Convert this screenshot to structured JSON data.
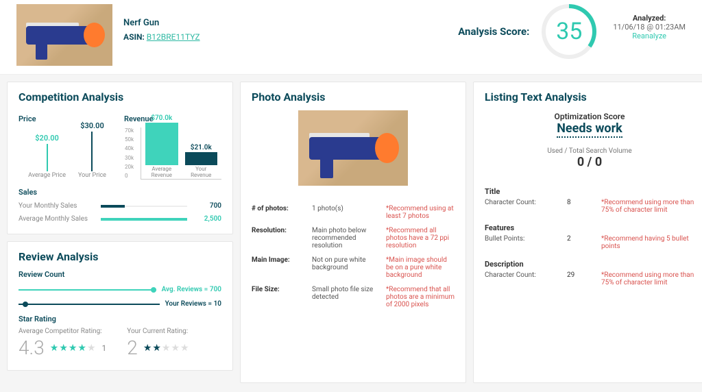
{
  "header": {
    "product_name": "Nerf Gun",
    "asin_label": "ASIN:",
    "asin_value": "B12BRE11TYZ",
    "score_label": "Analysis Score:",
    "score_value": "35",
    "analyzed_title": "Analyzed:",
    "analyzed_at": "11/06/18 @ 01:23AM",
    "reanalyze": "Reanalyze"
  },
  "competition": {
    "title": "Competition Analysis",
    "price_label": "Price",
    "revenue_label": "Revenue",
    "avg_price": "$20.00",
    "avg_price_cap": "Average\nPrice",
    "your_price": "$30.00",
    "your_price_cap": "Your\nPrice",
    "avg_rev": "$70.0k",
    "avg_rev_cap": "Average\nRevenue",
    "your_rev": "$21.0k",
    "your_rev_cap": "Your\nRevenue",
    "sales_label": "Sales",
    "your_sales_lbl": "Your Monthly Sales",
    "your_sales_val": "700",
    "avg_sales_lbl": "Average Monthly Sales",
    "avg_sales_val": "2,500",
    "ticks": [
      "70k",
      "50k",
      "40k",
      "30k",
      "20k",
      "0"
    ]
  },
  "review": {
    "title": "Review Analysis",
    "count_label": "Review Count",
    "avg_txt": "Avg. Reviews = 700",
    "your_txt": "Your Reviews = 10",
    "star_label": "Star Rating",
    "avg_lbl": "Average Competitor Rating:",
    "avg_val": "4.3",
    "your_lbl": "Your Current Rating:",
    "your_val": "2",
    "count_suffix": "1"
  },
  "photo": {
    "title": "Photo Analysis",
    "rows": {
      "count": {
        "k": "# of photos:",
        "v": "1 photo(s)",
        "rec": "*Recommend using at least 7 photos"
      },
      "res": {
        "k": "Resolution:",
        "v": "Main photo below recommended resolution",
        "rec": "*Recommend all photos have a 72 ppi resolution"
      },
      "main": {
        "k": "Main Image:",
        "v": "Not on pure white background",
        "rec": "*Main image should be on a pure white background"
      },
      "size": {
        "k": "File Size:",
        "v": "Small photo file size detected",
        "rec": "*Recommend that all photos are a minimum of 2000 pixels"
      }
    }
  },
  "listing": {
    "title": "Listing Text Analysis",
    "opt_label": "Optimization Score",
    "opt_value": "Needs work",
    "sv_label": "Used / Total Search Volume",
    "sv_value": "0 / 0",
    "sections": {
      "title": {
        "h": "Title",
        "k": "Character Count:",
        "v": "8",
        "rec": "*Recommend using more than 75% of character limit"
      },
      "features": {
        "h": "Features",
        "k": "Bullet Points:",
        "v": "2",
        "rec": "*Recommend having 5 bullet points"
      },
      "description": {
        "h": "Description",
        "k": "Character Count:",
        "v": "29",
        "rec": "*Recommend using more than 75% of character limit"
      }
    }
  },
  "chart_data": [
    {
      "type": "bar",
      "title": "Price",
      "categories": [
        "Average Price",
        "Your Price"
      ],
      "values": [
        20.0,
        30.0
      ],
      "ylabel": "USD"
    },
    {
      "type": "bar",
      "title": "Revenue",
      "categories": [
        "Average Revenue",
        "Your Revenue"
      ],
      "values": [
        70000,
        21000
      ],
      "ylabel": "USD",
      "ylim": [
        0,
        70000
      ]
    },
    {
      "type": "bar",
      "title": "Sales",
      "categories": [
        "Your Monthly Sales",
        "Average Monthly Sales"
      ],
      "values": [
        700,
        2500
      ]
    },
    {
      "type": "bar",
      "title": "Review Count",
      "categories": [
        "Avg. Reviews",
        "Your Reviews"
      ],
      "values": [
        700,
        10
      ]
    },
    {
      "type": "bar",
      "title": "Star Rating",
      "categories": [
        "Average Competitor Rating",
        "Your Current Rating"
      ],
      "values": [
        4.3,
        2
      ],
      "ylim": [
        0,
        5
      ]
    }
  ]
}
